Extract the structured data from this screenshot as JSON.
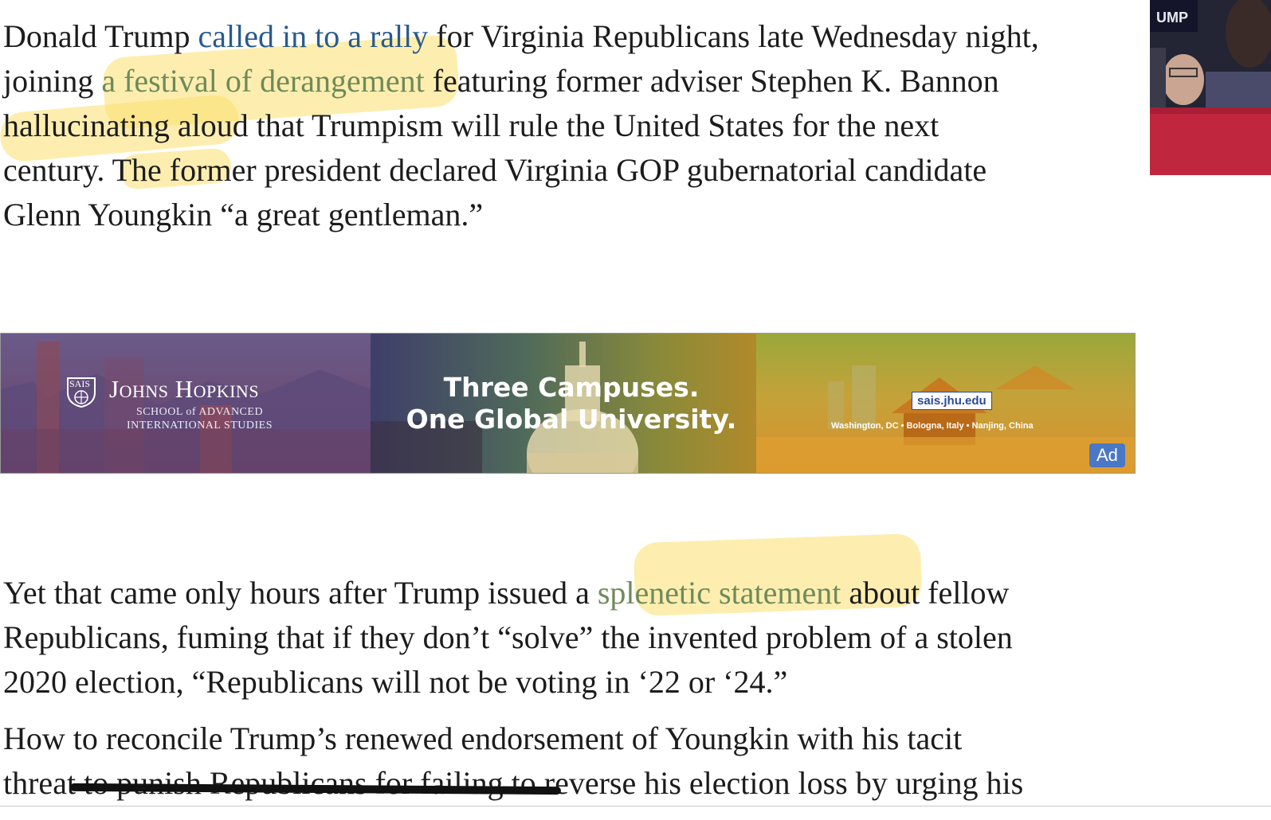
{
  "article": {
    "p1": {
      "l1_a": "Donald Trump ",
      "l1_link": "called in to a rally",
      "l1_b": " for Virginia Republicans late Wednesday night,",
      "l2_a": "joining ",
      "l2_link": "a festival of derangement",
      "l2_b": " featuring former adviser Stephen K. Bannon",
      "l3": "hallucinating aloud that Trumpism will rule the United States for the next",
      "l4": "century. The former president declared Virginia GOP gubernatorial candidate",
      "l5": "Glenn Youngkin “a great gentleman.”"
    },
    "p2": {
      "l1_a": "Yet that came only hours after Trump issued a ",
      "l1_link": "splenetic statement",
      "l1_b": " about fellow",
      "l2": "Republicans, fuming that if they don’t “solve” the invented problem of a stolen",
      "l3": "2020 election, “Republicans will not be voting in ‘22 or ‘24.”"
    },
    "p3": {
      "l1": "How to reconcile Trump’s renewed endorsement of Youngkin with his tacit",
      "l2": "threat to punish Republicans for failing to reverse his election loss by urging his"
    }
  },
  "side_image": {
    "sign_text": "UMP"
  },
  "ad": {
    "logo_text": "SAIS",
    "brand": "Johns Hopkins",
    "sub1": "SCHOOL of ADVANCED",
    "sub2": "INTERNATIONAL STUDIES",
    "headline1": "Three Campuses.",
    "headline2": "One Global University.",
    "url": "sais.jhu.edu",
    "locations": "Washington, DC  •  Bologna, Italy  •  Nanjing, China",
    "badge": "Ad"
  },
  "colors": {
    "link": "#2a5a8c",
    "highlight": "#fce06e",
    "ad_badge": "#4a78c4"
  }
}
